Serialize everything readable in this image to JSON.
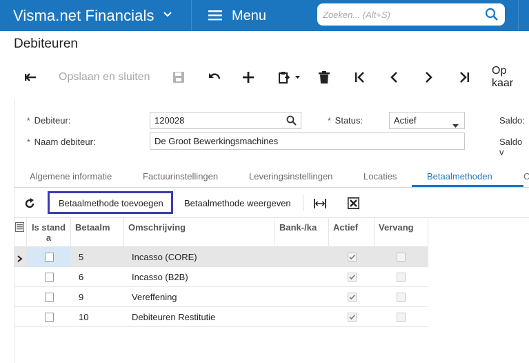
{
  "app": {
    "brand": "Visma.net Financials",
    "menu_label": "Menu"
  },
  "search": {
    "placeholder": "Zoeken... (Alt+S)"
  },
  "page": {
    "title": "Debiteuren"
  },
  "toolbar": {
    "save_close": "Opslaan en sluiten",
    "op_kaart": "Op kaar"
  },
  "form": {
    "debiteur_label": "Debiteur:",
    "debiteur_value": "120028",
    "naam_label": "Naam debiteur:",
    "naam_value": "De Groot Bewerkingsmachines",
    "status_label": "Status:",
    "status_value": "Actief",
    "saldo_label": "Saldo:",
    "saldo_v_label": "Saldo v"
  },
  "tabs": [
    {
      "label": "Algemene informatie"
    },
    {
      "label": "Factuurinstellingen"
    },
    {
      "label": "Leveringsinstellingen"
    },
    {
      "label": "Locaties"
    },
    {
      "label": "Betaalmethoden"
    },
    {
      "label": "C"
    }
  ],
  "grid_toolbar": {
    "add_label": "Betaalmethode toevoegen",
    "view_label": "Betaalmethode weergeven"
  },
  "grid": {
    "headers": {
      "is_standard": "Is standa",
      "betaalm": "Betaalm",
      "omschrijving": "Omschrijving",
      "bank": "Bank-/ka",
      "actief": "Actief",
      "vervang": "Vervang"
    },
    "rows": [
      {
        "code": "5",
        "desc": "Incasso (CORE)"
      },
      {
        "code": "6",
        "desc": "Incasso (B2B)"
      },
      {
        "code": "9",
        "desc": "Vereffening"
      },
      {
        "code": "10",
        "desc": "Debiteuren Restitutie"
      }
    ]
  }
}
